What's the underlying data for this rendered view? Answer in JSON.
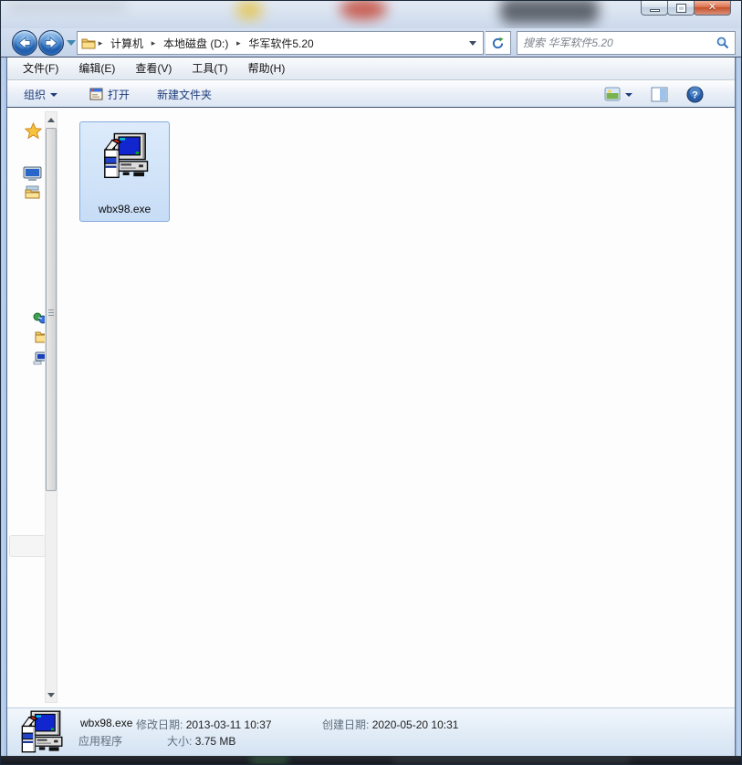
{
  "navigation": {
    "breadcrumb": [
      "计算机",
      "本地磁盘 (D:)",
      "华军软件5.20"
    ],
    "search_placeholder": "搜索 华军软件5.20"
  },
  "menubar": {
    "items": [
      {
        "label": "文件(F)"
      },
      {
        "label": "编辑(E)"
      },
      {
        "label": "查看(V)"
      },
      {
        "label": "工具(T)"
      },
      {
        "label": "帮助(H)"
      }
    ]
  },
  "toolbar": {
    "organize_label": "组织",
    "open_label": "打开",
    "new_folder_label": "新建文件夹"
  },
  "files": [
    {
      "name": "wbx98.exe",
      "selected": true
    }
  ],
  "details_pane": {
    "file_name": "wbx98.exe",
    "modified_label": "修改日期:",
    "modified_value": "2013-03-11 10:37",
    "created_label": "创建日期:",
    "created_value": "2020-05-20 10:31",
    "type_value": "应用程序",
    "size_label": "大小:",
    "size_value": "3.75 MB"
  },
  "colors": {
    "selection_border": "#84acdd",
    "selection_fill": "#d2e4f8",
    "toolbar_text": "#1e3c7b",
    "close_button": "#c64f28",
    "details_bg": "#dfeaf6"
  }
}
